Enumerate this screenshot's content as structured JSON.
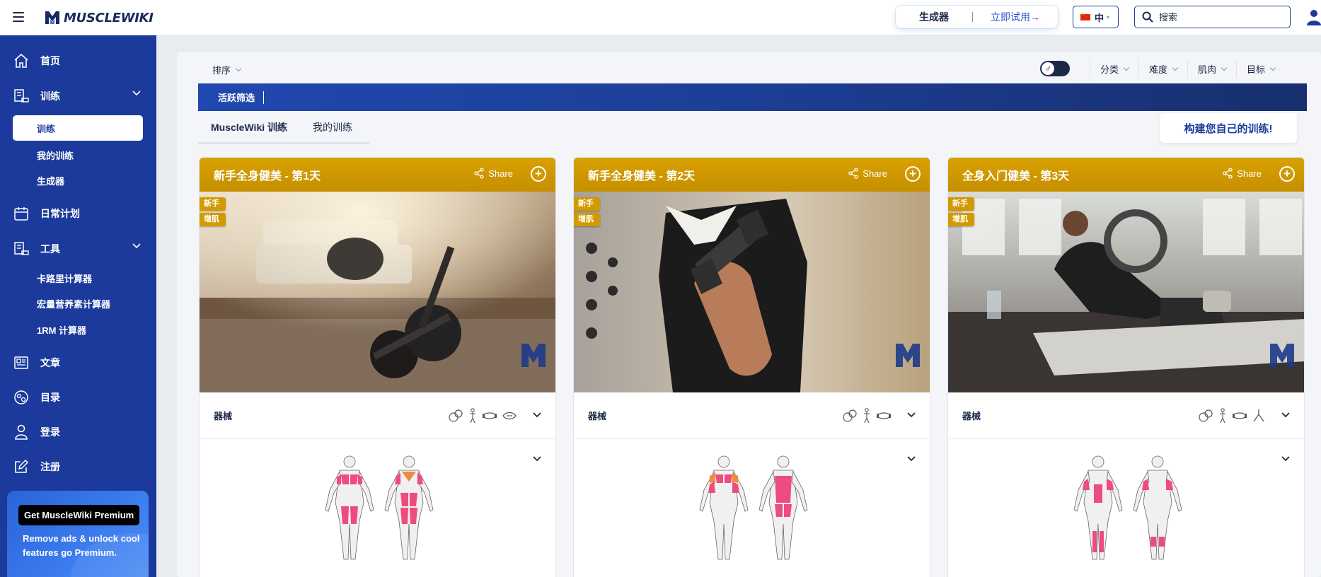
{
  "header": {
    "logo_text": "MUSCLEWIKI",
    "generator_label": "生成器",
    "generator_try": "立即试用→",
    "lang": "中",
    "search_placeholder": "搜索"
  },
  "sidebar": {
    "home": "首页",
    "workouts": "训练",
    "workouts_sub": [
      "训练",
      "我的训练",
      "生成器"
    ],
    "daily_plan": "日常计划",
    "tools": "工具",
    "tools_sub": [
      "卡路里计算器",
      "宏量营养素计算器",
      "1RM 计算器"
    ],
    "articles": "文章",
    "directory": "目录",
    "login": "登录",
    "register": "注册",
    "premium_button": "Get MuscleWiki Premium",
    "premium_text": "Remove ads & unlock cool features go Premium."
  },
  "main": {
    "sort": "排序",
    "filters": [
      "分类",
      "难度",
      "肌肉",
      "目标"
    ],
    "active_filters": "活跃筛选",
    "tabs": [
      "MuscleWiki 训练",
      "我的训练"
    ],
    "build_button": "构建您自己的训练!",
    "equipment_label": "器械"
  },
  "cards": [
    {
      "title": "新手全身健美 - 第1天",
      "share": "Share",
      "tags": [
        "新手",
        "增肌"
      ]
    },
    {
      "title": "新手全身健美 - 第2天",
      "share": "Share",
      "tags": [
        "新手",
        "增肌"
      ]
    },
    {
      "title": "全身入门健美 - 第3天",
      "share": "Share",
      "tags": [
        "新手",
        "增肌"
      ]
    }
  ],
  "colors": {
    "sidebar_bg": "#1b3a9c",
    "card_header": "#d29a00",
    "muscle_pink": "#ee4b7e",
    "muscle_orange": "#f08a3c"
  }
}
